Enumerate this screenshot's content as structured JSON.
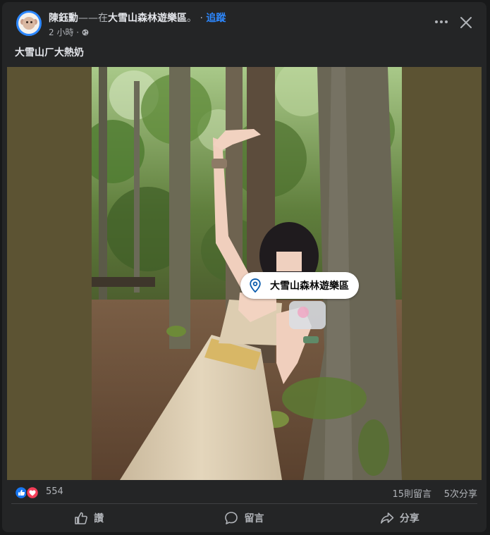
{
  "post": {
    "author_name": "陳鈺勳",
    "dash": "——",
    "at_text": "在",
    "location_name": "大雪山森林遊樂區",
    "trail": "。 · ",
    "follow_label": "追蹤",
    "time": "2 小時",
    "dot": " · ",
    "privacy_icon": "globe-icon",
    "text": "大雪山ㄏ大熱奶"
  },
  "media": {
    "location_tag": "大雪山森林遊樂區",
    "pin_icon": "location-pin-icon"
  },
  "stats": {
    "reaction_icons": [
      "like-icon",
      "love-icon"
    ],
    "reaction_count": "554",
    "comments": "15則留言",
    "shares": "5次分享"
  },
  "actions": {
    "like_label": "讚",
    "comment_label": "留言",
    "share_label": "分享"
  },
  "colors": {
    "background": "#242526",
    "accent": "#2d88ff",
    "media_pad": "#5c5333",
    "like": "#1877f2",
    "love": "#f33e58"
  }
}
